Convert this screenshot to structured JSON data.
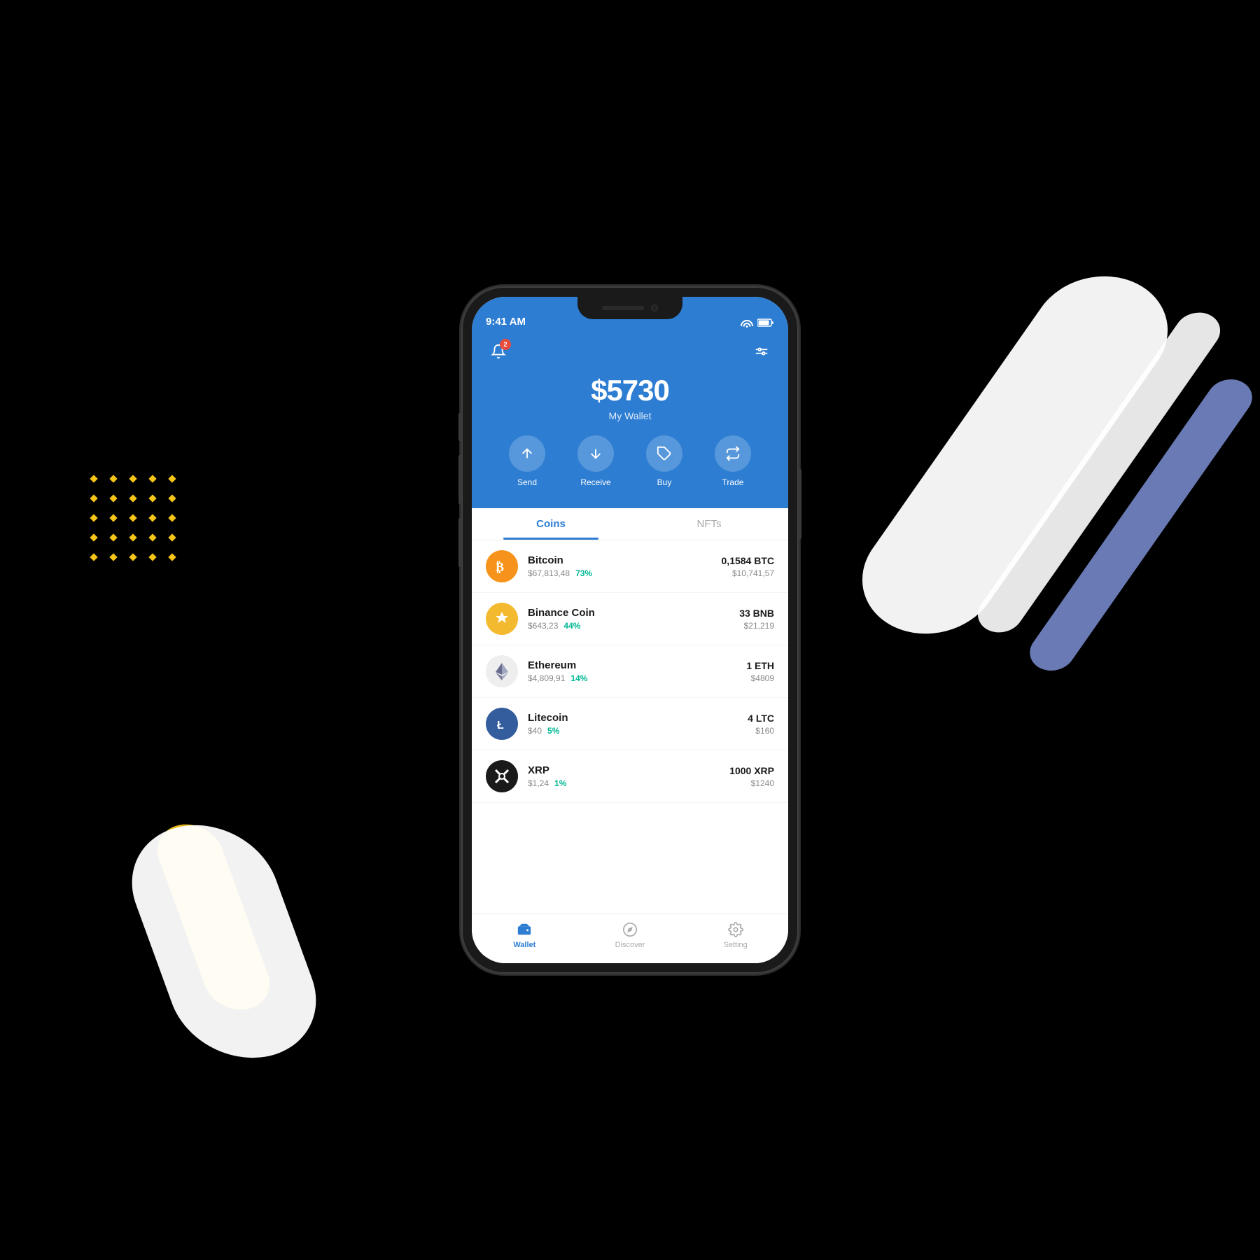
{
  "background": "#000000",
  "statusBar": {
    "time": "9:41 AM"
  },
  "header": {
    "notificationCount": "2",
    "totalAmount": "$5730",
    "walletLabel": "My Wallet"
  },
  "actions": [
    {
      "id": "send",
      "label": "Send"
    },
    {
      "id": "receive",
      "label": "Receive"
    },
    {
      "id": "buy",
      "label": "Buy"
    },
    {
      "id": "trade",
      "label": "Trade"
    }
  ],
  "tabs": [
    {
      "id": "coins",
      "label": "Coins",
      "active": true
    },
    {
      "id": "nfts",
      "label": "NFTs",
      "active": false
    }
  ],
  "coins": [
    {
      "id": "btc",
      "name": "Bitcoin",
      "price": "$67,813,48",
      "change": "73%",
      "amount": "0,1584 BTC",
      "value": "$10,741,57",
      "iconClass": "btc"
    },
    {
      "id": "bnb",
      "name": "Binance Coin",
      "price": "$643,23",
      "change": "44%",
      "amount": "33 BNB",
      "value": "$21,219",
      "iconClass": "bnb"
    },
    {
      "id": "eth",
      "name": "Ethereum",
      "price": "$4,809,91",
      "change": "14%",
      "amount": "1 ETH",
      "value": "$4809",
      "iconClass": "eth"
    },
    {
      "id": "ltc",
      "name": "Litecoin",
      "price": "$40",
      "change": "5%",
      "amount": "4 LTC",
      "value": "$160",
      "iconClass": "ltc"
    },
    {
      "id": "xrp",
      "name": "XRP",
      "price": "$1,24",
      "change": "1%",
      "amount": "1000 XRP",
      "value": "$1240",
      "iconClass": "xrp"
    }
  ],
  "bottomNav": [
    {
      "id": "wallet",
      "label": "Wallet",
      "active": true
    },
    {
      "id": "discover",
      "label": "Discover",
      "active": false
    },
    {
      "id": "setting",
      "label": "Setting",
      "active": false
    }
  ]
}
